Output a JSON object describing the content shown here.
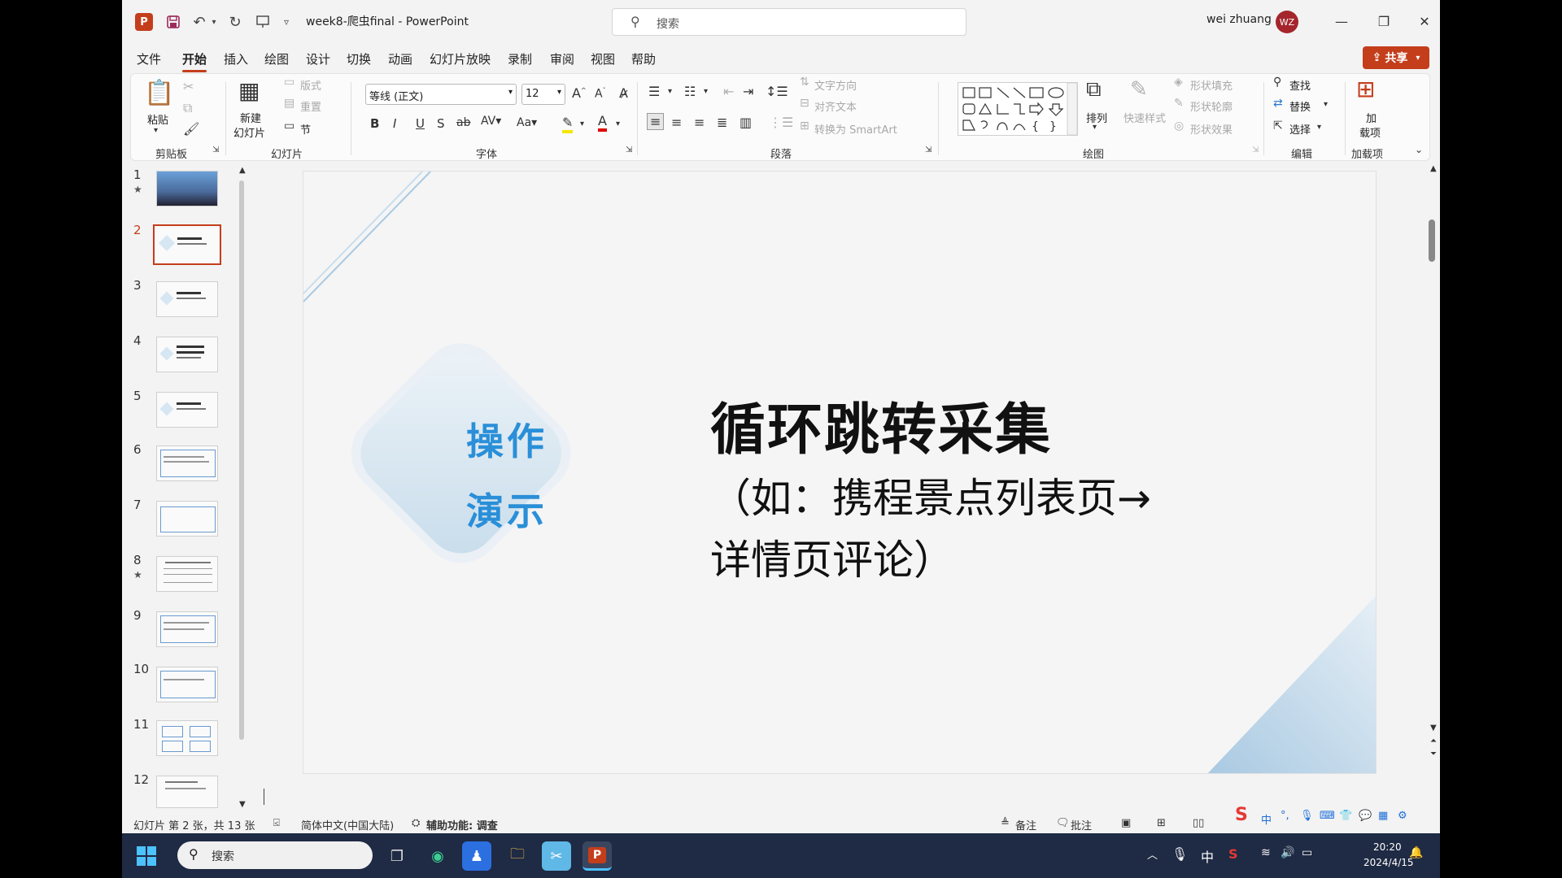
{
  "titlebar": {
    "app_logo": "P",
    "doc_title": "week8-爬虫final  -  PowerPoint",
    "search_placeholder": "搜索",
    "user_name": "wei zhuang",
    "user_initials": "WZ"
  },
  "menu": {
    "tabs": [
      "文件",
      "开始",
      "插入",
      "绘图",
      "设计",
      "切换",
      "动画",
      "幻灯片放映",
      "录制",
      "审阅",
      "视图",
      "帮助"
    ],
    "active_tab": "开始",
    "share_label": "共享"
  },
  "ribbon": {
    "clipboard": {
      "paste": "粘贴",
      "group": "剪贴板"
    },
    "slides": {
      "new_slide_1": "新建",
      "new_slide_2": "幻灯片",
      "layout": "版式",
      "reset": "重置",
      "section": "节",
      "group": "幻灯片"
    },
    "font": {
      "font_name": "等线 (正文)",
      "font_size": "12",
      "group": "字体"
    },
    "paragraph": {
      "text_direction": "文字方向",
      "align_text": "对齐文本",
      "smartart": "转换为 SmartArt",
      "group": "段落"
    },
    "drawing": {
      "arrange": "排列",
      "quick_styles": "快速样式",
      "shape_fill": "形状填充",
      "shape_outline": "形状轮廓",
      "shape_effects": "形状效果",
      "group": "绘图"
    },
    "editing": {
      "find": "查找",
      "replace": "替换",
      "select": "选择",
      "group": "编辑"
    },
    "addins": {
      "addins_1": "加",
      "addins_2": "载项",
      "group": "加载项"
    }
  },
  "thumbnails": {
    "numbers": [
      "1",
      "2",
      "3",
      "4",
      "5",
      "6",
      "7",
      "8",
      "9",
      "10",
      "11",
      "12"
    ],
    "active": "2",
    "starred": [
      "1",
      "8"
    ],
    "star_glyph": "★"
  },
  "slide": {
    "diamond_line1": "操作",
    "diamond_line2": "演示",
    "title": "循环跳转采集",
    "subtitle_line1": "（如：携程景点列表页→",
    "subtitle_line2": "详情页评论）"
  },
  "statusbar": {
    "slide_info": "幻灯片 第 2 张，共 13 张",
    "language": "简体中文(中国大陆)",
    "accessibility": "辅助功能: 调查",
    "notes": "备注",
    "comments": "批注"
  },
  "taskbar": {
    "search_placeholder": "搜索",
    "ime_lang": "中",
    "time": "20:20",
    "date": "2024/4/15"
  }
}
